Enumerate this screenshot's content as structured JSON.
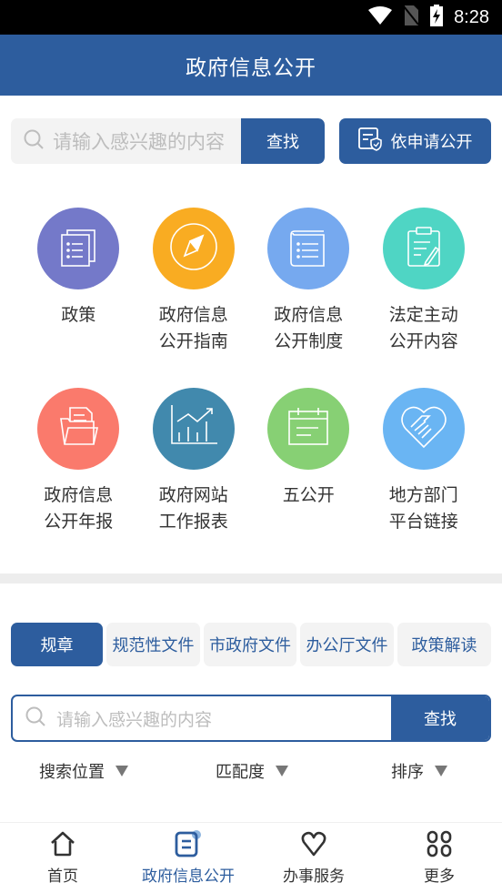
{
  "status_bar": {
    "time": "8:28",
    "icons": [
      "wifi-icon",
      "no-sim-icon",
      "battery-charging-icon"
    ]
  },
  "header": {
    "title": "政府信息公开"
  },
  "top_search": {
    "placeholder": "请输入感兴趣的内容",
    "button_label": "查找",
    "icon": "search-icon"
  },
  "apply_button": {
    "label": "依申请公开",
    "icon": "shield-document-icon"
  },
  "grid": [
    {
      "line1": "政策",
      "line2": "",
      "icon": "documents-icon",
      "color": "#7479c9"
    },
    {
      "line1": "政府信息",
      "line2": "公开指南",
      "icon": "compass-icon",
      "color": "#f9ac22"
    },
    {
      "line1": "政府信息",
      "line2": "公开制度",
      "icon": "book-icon",
      "color": "#76a9ef"
    },
    {
      "line1": "法定主动",
      "line2": "公开内容",
      "icon": "clipboard-edit-icon",
      "color": "#4fd5c4"
    },
    {
      "line1": "政府信息",
      "line2": "公开年报",
      "icon": "folder-icon",
      "color": "#fa7a6c"
    },
    {
      "line1": "政府网站",
      "line2": "工作报表",
      "icon": "chart-icon",
      "color": "#4189ad"
    },
    {
      "line1": "五公开",
      "line2": "",
      "icon": "calendar-icon",
      "color": "#87d074"
    },
    {
      "line1": "地方部门",
      "line2": "平台链接",
      "icon": "handshake-icon",
      "color": "#6ab5f3"
    }
  ],
  "tabs": [
    {
      "label": "规章",
      "active": true
    },
    {
      "label": "规范性文件",
      "active": false
    },
    {
      "label": "市政府文件",
      "active": false
    },
    {
      "label": "办公厅文件",
      "active": false
    },
    {
      "label": "政策解读",
      "active": false
    }
  ],
  "search2": {
    "placeholder": "请输入感兴趣的内容",
    "button_label": "查找",
    "icon": "search-icon"
  },
  "filters": [
    {
      "label": "搜索位置",
      "icon": "dropdown-triangle-icon"
    },
    {
      "label": "匹配度",
      "icon": "dropdown-triangle-icon"
    },
    {
      "label": "排序",
      "icon": "dropdown-triangle-icon"
    }
  ],
  "bottom_nav": [
    {
      "label": "首页",
      "icon": "home-icon",
      "active": false
    },
    {
      "label": "政府信息公开",
      "icon": "document-icon",
      "active": true
    },
    {
      "label": "办事服务",
      "icon": "heart-icon",
      "active": false
    },
    {
      "label": "更多",
      "icon": "grid-more-icon",
      "active": false
    }
  ],
  "colors": {
    "primary": "#2d5d9e",
    "tab_bg": "#f3f3f3",
    "divider": "#ededed"
  }
}
